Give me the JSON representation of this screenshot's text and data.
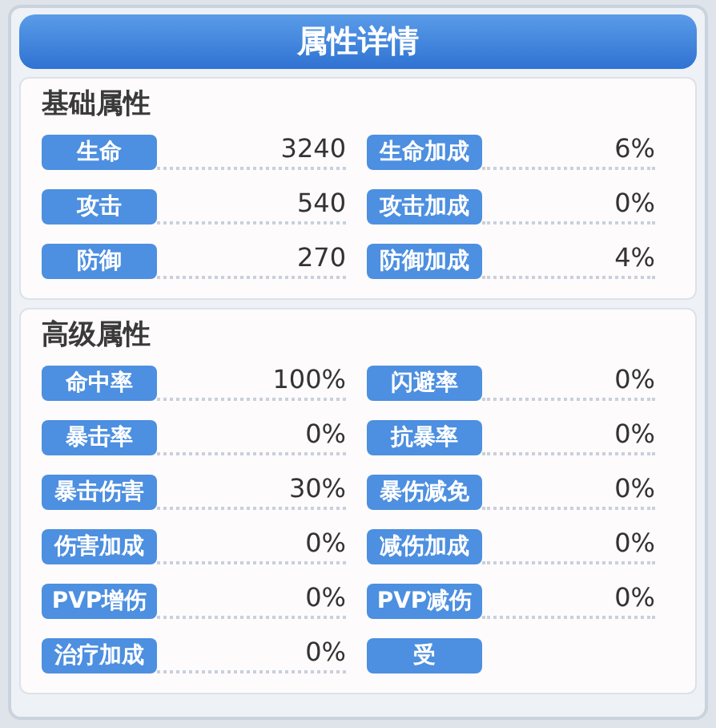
{
  "title": "属性详情",
  "sections": [
    {
      "heading": "基础属性",
      "rows": [
        [
          {
            "label": "生命",
            "value": "3240"
          },
          {
            "label": "生命加成",
            "value": "6%"
          }
        ],
        [
          {
            "label": "攻击",
            "value": "540"
          },
          {
            "label": "攻击加成",
            "value": "0%"
          }
        ],
        [
          {
            "label": "防御",
            "value": "270"
          },
          {
            "label": "防御加成",
            "value": "4%"
          }
        ]
      ]
    },
    {
      "heading": "高级属性",
      "rows": [
        [
          {
            "label": "命中率",
            "value": "100%"
          },
          {
            "label": "闪避率",
            "value": "0%"
          }
        ],
        [
          {
            "label": "暴击率",
            "value": "0%"
          },
          {
            "label": "抗暴率",
            "value": "0%"
          }
        ],
        [
          {
            "label": "暴击伤害",
            "value": "30%"
          },
          {
            "label": "暴伤减免",
            "value": "0%"
          }
        ],
        [
          {
            "label": "伤害加成",
            "value": "0%"
          },
          {
            "label": "减伤加成",
            "value": "0%"
          }
        ],
        [
          {
            "label": "PVP增伤",
            "value": "0%"
          },
          {
            "label": "PVP减伤",
            "value": "0%"
          }
        ],
        [
          {
            "label": "治疗加成",
            "value": "0%"
          },
          {
            "label": "受"
          }
        ]
      ]
    }
  ]
}
